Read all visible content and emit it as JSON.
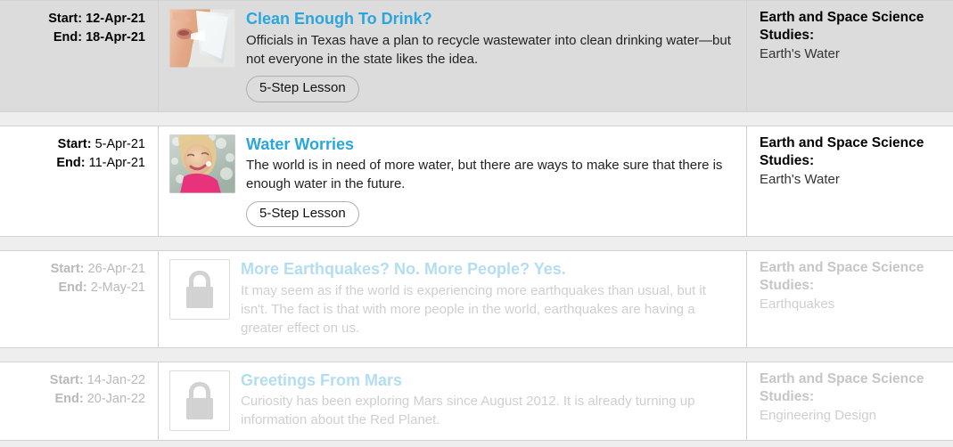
{
  "list": {
    "rows": [
      {
        "id": "clean-enough-to-drink",
        "state": "shaded",
        "locked": false,
        "dates_all_bold": true,
        "start_label": "Start:",
        "start_value": "12-Apr-21",
        "end_label": "End:",
        "end_value": "18-Apr-21",
        "thumbnail": "photo-person-drinking-water",
        "title": "Clean Enough To Drink?",
        "description": "Officials in Texas have a plan to recycle wastewater into clean drinking water—but not everyone in the state likes the idea.",
        "button_label": "5-Step Lesson",
        "has_button": true,
        "topic_heading": "Earth and Space Science Studies:",
        "topic_subject": "Earth's Water"
      },
      {
        "id": "water-worries",
        "state": "normal",
        "locked": false,
        "dates_all_bold": false,
        "start_label": "Start:",
        "start_value": "5-Apr-21",
        "end_label": "End:",
        "end_value": "11-Apr-21",
        "thumbnail": "photo-girl-in-water-spray",
        "title": "Water Worries",
        "description": "The world is in need of more water, but there are ways to make sure that there is enough water in the future.",
        "button_label": "5-Step Lesson",
        "has_button": true,
        "topic_heading": "Earth and Space Science Studies:",
        "topic_subject": "Earth's Water"
      },
      {
        "id": "more-earthquakes-no-more-people-yes",
        "state": "normal",
        "locked": true,
        "dates_all_bold": false,
        "start_label": "Start:",
        "start_value": "26-Apr-21",
        "end_label": "End:",
        "end_value": "2-May-21",
        "thumbnail": "lock-icon",
        "title": "More Earthquakes? No. More People? Yes.",
        "description": "It may seem as if the world is experiencing more earthquakes than usual, but it isn't. The fact is that with more people in the world, earthquakes are having a greater effect on us.",
        "button_label": "",
        "has_button": false,
        "topic_heading": "Earth and Space Science Studies:",
        "topic_subject": "Earthquakes"
      },
      {
        "id": "greetings-from-mars",
        "state": "normal",
        "locked": true,
        "dates_all_bold": false,
        "start_label": "Start:",
        "start_value": "14-Jan-22",
        "end_label": "End:",
        "end_value": "20-Jan-22",
        "thumbnail": "lock-icon",
        "title": "Greetings From Mars",
        "description": "Curiosity has been exploring Mars since August 2012. It is already turning up information about the Red Planet.",
        "button_label": "",
        "has_button": false,
        "topic_heading": "Earth and Space Science Studies:",
        "topic_subject": "Engineering Design"
      }
    ]
  },
  "colors": {
    "link_blue": "#2ba6dd",
    "link_blue_faded": "#b3ddf0",
    "row_shaded_bg": "#dcdcdc",
    "gap_bg": "#eeeeee",
    "border": "#d3d3d3",
    "locked_text": "#cfcfcf"
  }
}
